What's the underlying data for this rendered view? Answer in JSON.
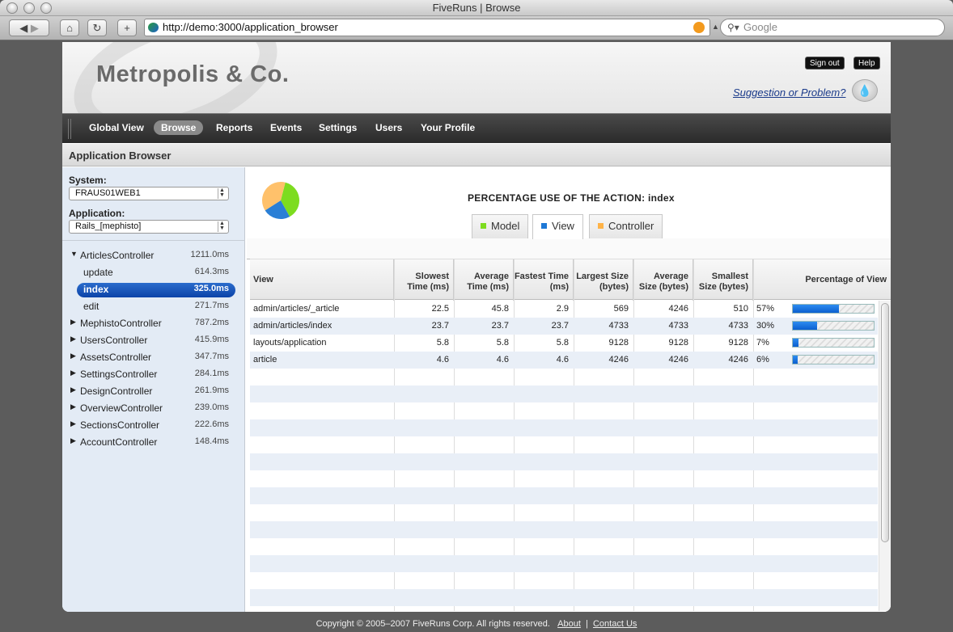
{
  "window": {
    "title": "FiveRuns | Browse",
    "url": "http://demo:3000/application_browser",
    "search_placeholder": "Google"
  },
  "header": {
    "logo": "Metropolis & Co.",
    "sign_out": "Sign out",
    "help": "Help",
    "suggestion": "Suggestion or Problem?"
  },
  "nav": {
    "items": [
      "Global View",
      "Browse",
      "Reports",
      "Events",
      "Settings",
      "Users",
      "Your Profile"
    ],
    "active": "Browse"
  },
  "subheader": "Application Browser",
  "sidebar": {
    "system_label": "System:",
    "system_value": "FRAUS01WEB1",
    "application_label": "Application:",
    "application_value": "Rails_[mephisto]",
    "tree": [
      {
        "name": "ArticlesController",
        "time": "1211.0ms",
        "expanded": true
      },
      {
        "name": "update",
        "time": "614.3ms",
        "child": true
      },
      {
        "name": "index",
        "time": "325.0ms",
        "child": true,
        "selected": true
      },
      {
        "name": "edit",
        "time": "271.7ms",
        "child": true
      },
      {
        "name": "MephistoController",
        "time": "787.2ms"
      },
      {
        "name": "UsersController",
        "time": "415.9ms"
      },
      {
        "name": "AssetsController",
        "time": "347.7ms"
      },
      {
        "name": "SettingsController",
        "time": "284.1ms"
      },
      {
        "name": "DesignController",
        "time": "261.9ms"
      },
      {
        "name": "OverviewController",
        "time": "239.0ms"
      },
      {
        "name": "SectionsController",
        "time": "222.6ms"
      },
      {
        "name": "AccountController",
        "time": "148.4ms"
      }
    ]
  },
  "main": {
    "title": "PERCENTAGE USE OF THE ACTION: index",
    "tabs": [
      {
        "label": "Model",
        "color": "#7ddc1f",
        "active": false
      },
      {
        "label": "View",
        "color": "#1e78d6",
        "active": true
      },
      {
        "label": "Controller",
        "color": "#ffb347",
        "active": false
      }
    ],
    "columns": [
      "View",
      "Slowest Time (ms)",
      "Average Time (ms)",
      "Fastest Time (ms)",
      "Largest Size (bytes)",
      "Average Size (bytes)",
      "Smallest Size (bytes)",
      "Percentage of View"
    ],
    "rows": [
      {
        "view": "admin/articles/_article",
        "slowest": "22.5",
        "average": "45.8",
        "fastest": "2.9",
        "largest": "569",
        "avg_size": "4246",
        "smallest": "510",
        "pct": "57%",
        "pct_value": 0.57
      },
      {
        "view": "admin/articles/index",
        "slowest": "23.7",
        "average": "23.7",
        "fastest": "23.7",
        "largest": "4733",
        "avg_size": "4733",
        "smallest": "4733",
        "pct": "30%",
        "pct_value": 0.3
      },
      {
        "view": "layouts/application",
        "slowest": "5.8",
        "average": "5.8",
        "fastest": "5.8",
        "largest": "9128",
        "avg_size": "9128",
        "smallest": "9128",
        "pct": "7%",
        "pct_value": 0.07
      },
      {
        "view": "article",
        "slowest": "4.6",
        "average": "4.6",
        "fastest": "4.6",
        "largest": "4246",
        "avg_size": "4246",
        "smallest": "4246",
        "pct": "6%",
        "pct_value": 0.06
      }
    ],
    "pie": [
      {
        "name": "Model",
        "value": 0.38,
        "color": "#7ddc1f"
      },
      {
        "name": "View",
        "value": 0.24,
        "color": "#2a7fd6"
      },
      {
        "name": "Controller",
        "value": 0.38,
        "color": "#ffc16b"
      }
    ]
  },
  "footer": {
    "copyright": "Copyright © 2005–2007 FiveRuns Corp. All rights reserved.",
    "about": "About",
    "separator": "|",
    "contact": "Contact Us"
  }
}
